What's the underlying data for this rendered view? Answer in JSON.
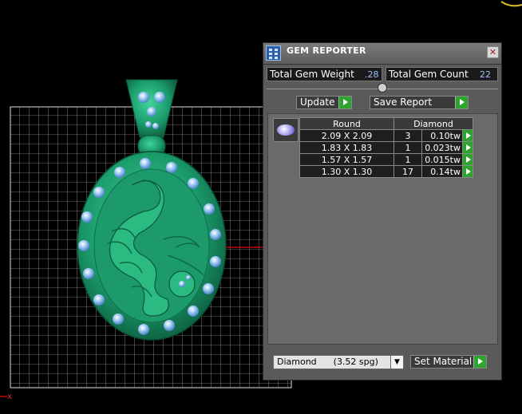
{
  "panel": {
    "title": "GEM REPORTER",
    "close_glyph": "✕",
    "total_weight_label": "Total Gem Weight",
    "total_weight_value": ".28",
    "total_count_label": "Total Gem Count",
    "total_count_value": "22",
    "update_label": "Update",
    "save_report_label": "Save Report",
    "table": {
      "headers": [
        "Round",
        "Diamond"
      ],
      "rows": [
        {
          "size": "2.09 X 2.09",
          "count": "3",
          "weight": "0.10tw"
        },
        {
          "size": "1.83 X 1.83",
          "count": "1",
          "weight": "0.023tw"
        },
        {
          "size": "1.57 X 1.57",
          "count": "1",
          "weight": "0.015tw"
        },
        {
          "size": "1.30 X 1.30",
          "count": "17",
          "weight": "0.14tw"
        }
      ]
    },
    "material_select": "Diamond      (3.52 spg)",
    "set_material_label": "Set Material"
  },
  "viewport": {
    "axis_label": "x"
  },
  "colors": {
    "pendant": "#1f9e6e",
    "gem": "#7fb4ea",
    "grid": "#d8d8d8",
    "accent_button": "#2ea32e"
  }
}
